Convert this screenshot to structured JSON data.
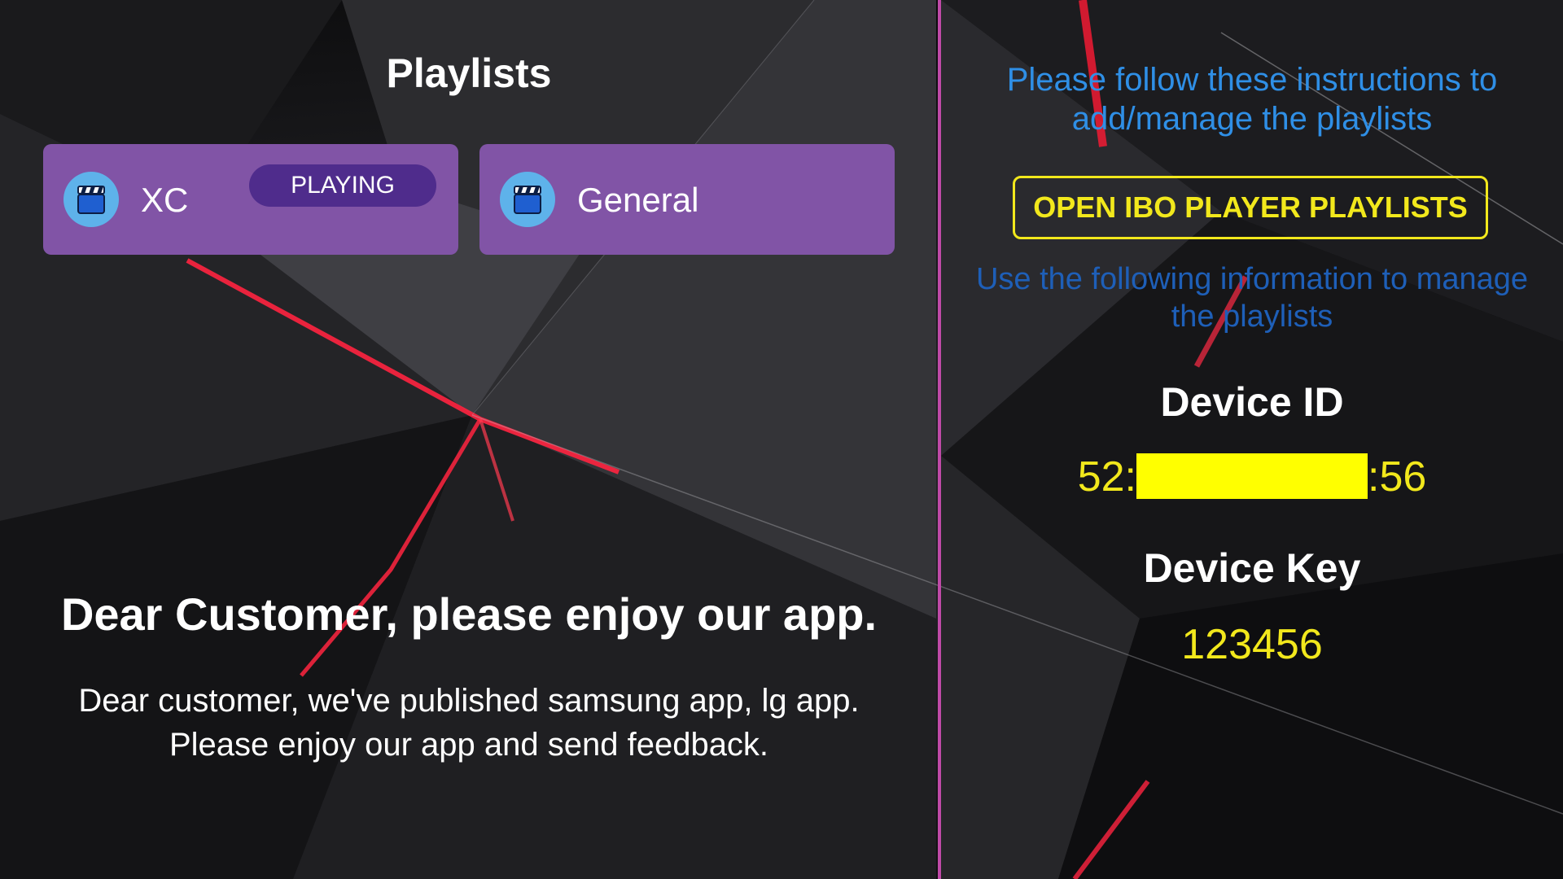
{
  "playlists": {
    "title": "Playlists",
    "items": [
      {
        "label": "XC",
        "badge": "PLAYING",
        "icon": "clapperboard-icon"
      },
      {
        "label": "General",
        "badge": "",
        "icon": "clapperboard-icon"
      }
    ]
  },
  "welcome": {
    "title": "Dear Customer, please enjoy our app.",
    "line1": "Dear customer, we've published samsung app, lg app.",
    "line2": "Please enjoy our app and send feedback."
  },
  "right": {
    "instructions_line1": "Please follow these instructions to",
    "instructions_line2": "add/manage the playlists",
    "open_button": "OPEN IBO PLAYER PLAYLISTS",
    "manage_line1": "Use the following information to manage",
    "manage_line2": "the playlists",
    "device_id_label": "Device ID",
    "device_id_prefix": "52:",
    "device_id_suffix": ":56",
    "device_key_label": "Device Key",
    "device_key_value": "123456"
  },
  "colors": {
    "card_bg": "#8154a6",
    "badge_bg": "#4f2c8c",
    "icon_circle": "#5eb2ea",
    "divider": "#c04aa8",
    "accent_yellow": "#f2e81c",
    "instructions_blue": "#2f8fe6",
    "manage_blue": "#1e5fb8",
    "redaction": "#ffff00"
  }
}
